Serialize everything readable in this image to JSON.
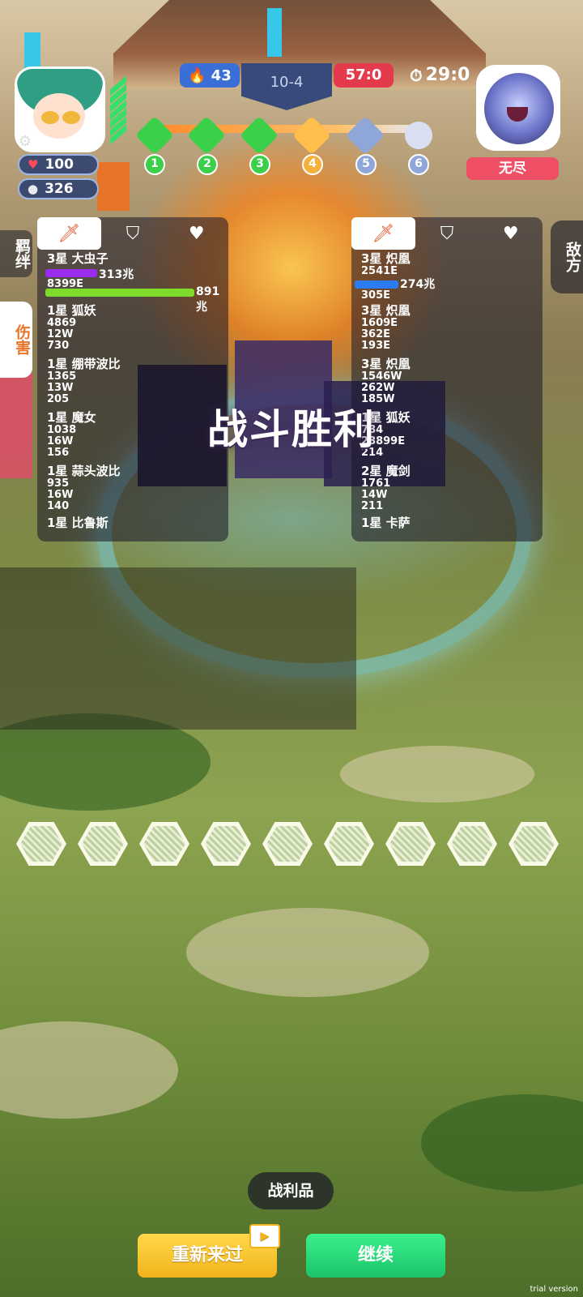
{
  "hud": {
    "player_hp": "100",
    "player_coins": "326",
    "flame_count": "43",
    "round": "10-4",
    "score": "57:0",
    "timer": "29:0",
    "boss_name": "无尽",
    "stages": [
      "1",
      "2",
      "3",
      "4",
      "5",
      "6"
    ]
  },
  "side_tabs": {
    "bond": "羁绊",
    "damage": "伤害",
    "enemy": "敌方"
  },
  "panel_tabs": {
    "attack_icon": "sword-icon",
    "defense_icon": "shield-icon",
    "heal_icon": "heart-icon"
  },
  "left_panel": {
    "top_unit": {
      "name": "3星 大虫子",
      "bar1_label": "313兆",
      "bar2_label": "891兆",
      "value": "8399E"
    },
    "units": [
      {
        "name": "1星 狐妖",
        "lines": [
          "4869",
          "12W",
          "730"
        ]
      },
      {
        "name": "1星 绷带波比",
        "lines": [
          "1365",
          "13W",
          "205"
        ]
      },
      {
        "name": "1星 魔女",
        "lines": [
          "1038",
          "16W",
          "156"
        ]
      },
      {
        "name": "1星 蒜头波比",
        "lines": [
          "935",
          "16W",
          "140"
        ]
      },
      {
        "name": "1星 比鲁斯",
        "lines": []
      }
    ]
  },
  "right_panel": {
    "top_unit": {
      "name": "3星 炽凰",
      "value": "2541E",
      "bar_label": "274兆",
      "line2": "305E"
    },
    "units": [
      {
        "name": "3星 炽凰",
        "lines": [
          "1609E",
          "362E",
          "193E"
        ]
      },
      {
        "name": "3星 炽凰",
        "lines": [
          "1546W",
          "262W",
          "185W"
        ]
      },
      {
        "name": "1星 狐妖",
        "lines": [
          "784",
          "28899E",
          "214"
        ]
      },
      {
        "name": "2星 魔剑",
        "lines": [
          "1761",
          "14W",
          "211"
        ]
      },
      {
        "name": "1星 卡萨",
        "lines": []
      }
    ]
  },
  "victory_text": "战斗胜利",
  "loot_label": "战利品",
  "buttons": {
    "retry": "重新来过",
    "continue": "继续"
  },
  "watermark": "trial version",
  "colors": {
    "accent_orange": "#e8562a",
    "continue_green": "#1cc46a",
    "retry_yellow": "#f2b31c",
    "score_red": "#e33b4c"
  }
}
